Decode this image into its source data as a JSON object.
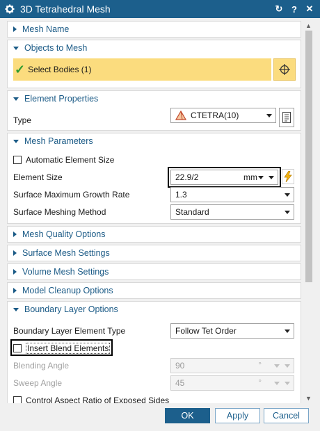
{
  "window": {
    "title": "3D Tetrahedral Mesh",
    "controls": {
      "reset_icon": "↻",
      "help_icon": "?",
      "close_icon": "✕"
    }
  },
  "sections": {
    "mesh_name": {
      "label": "Mesh Name"
    },
    "objects_to_mesh": {
      "label": "Objects to Mesh",
      "select_bodies": "Select Bodies (1)"
    },
    "element_properties": {
      "label": "Element Properties",
      "type_label": "Type",
      "type_value": "CTETRA(10)"
    },
    "mesh_parameters": {
      "label": "Mesh Parameters",
      "auto_size_label": "Automatic Element Size",
      "element_size_label": "Element Size",
      "element_size_value": "22.9/2",
      "element_size_unit": "mm",
      "growth_rate_label": "Surface Maximum Growth Rate",
      "growth_rate_value": "1.3",
      "meshing_method_label": "Surface Meshing Method",
      "meshing_method_value": "Standard"
    },
    "mesh_quality": {
      "label": "Mesh Quality Options"
    },
    "surface_mesh": {
      "label": "Surface Mesh Settings"
    },
    "volume_mesh": {
      "label": "Volume Mesh Settings"
    },
    "model_cleanup": {
      "label": "Model Cleanup Options"
    },
    "boundary_layer": {
      "label": "Boundary Layer Options",
      "element_type_label": "Boundary Layer Element Type",
      "element_type_value": "Follow Tet Order",
      "insert_blend_label": "Insert Blend Elements",
      "blending_angle_label": "Blending Angle",
      "blending_angle_value": "90",
      "sweep_angle_label": "Sweep Angle",
      "sweep_angle_value": "45",
      "degree_symbol": "°",
      "aspect_ratio_label": "Control Aspect Ratio of Exposed Sides"
    }
  },
  "footer": {
    "ok": "OK",
    "apply": "Apply",
    "cancel": "Cancel"
  },
  "colors": {
    "titlebar": "#1c5f8c",
    "highlight": "#fbdc7e",
    "accent": "#1a5a86"
  }
}
